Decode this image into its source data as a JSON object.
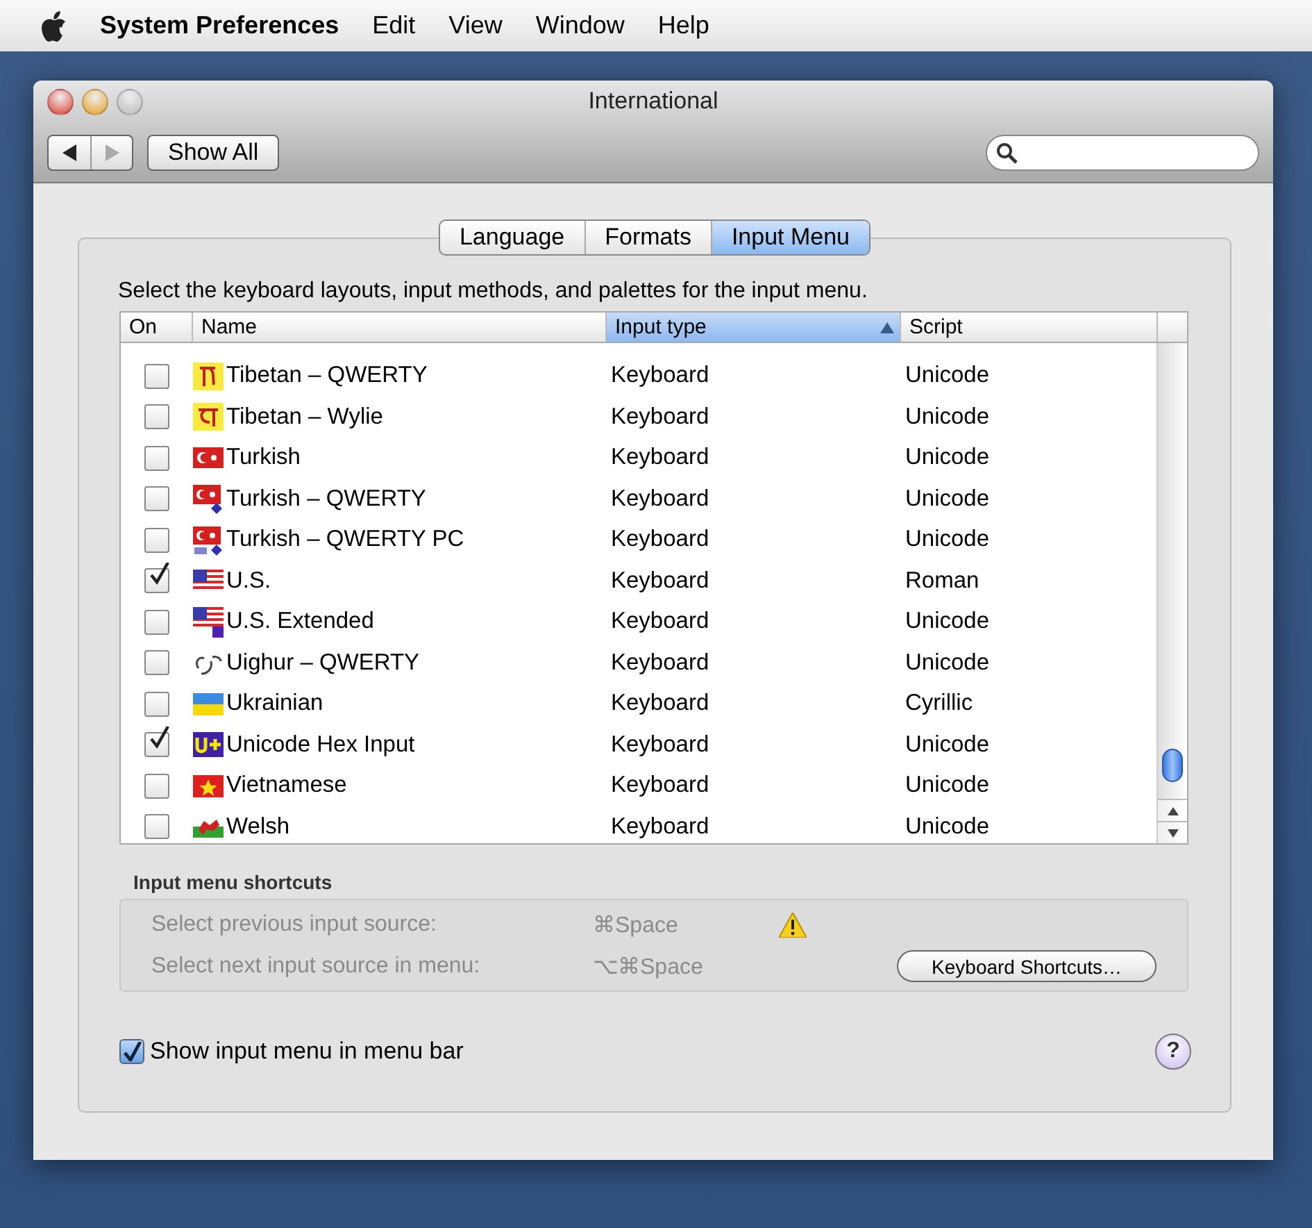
{
  "menu_bar": {
    "app": "System Preferences",
    "items": [
      "Edit",
      "View",
      "Window",
      "Help"
    ]
  },
  "window": {
    "title": "International",
    "show_all": "Show All"
  },
  "tabs": [
    {
      "label": "Language",
      "selected": false
    },
    {
      "label": "Formats",
      "selected": false
    },
    {
      "label": "Input Menu",
      "selected": true
    }
  ],
  "instruction": "Select the keyboard layouts, input methods, and palettes for the input menu.",
  "table": {
    "columns": [
      {
        "label": "On",
        "sorted": false
      },
      {
        "label": "Name",
        "sorted": false
      },
      {
        "label": "Input type",
        "sorted": true
      },
      {
        "label": "Script",
        "sorted": false
      }
    ],
    "rows": [
      {
        "checked": false,
        "name": "Tibetan – QWERTY",
        "type": "Keyboard",
        "script": "Unicode"
      },
      {
        "checked": false,
        "name": "Tibetan – Wylie",
        "type": "Keyboard",
        "script": "Unicode"
      },
      {
        "checked": false,
        "name": "Turkish",
        "type": "Keyboard",
        "script": "Unicode"
      },
      {
        "checked": false,
        "name": "Turkish – QWERTY",
        "type": "Keyboard",
        "script": "Unicode"
      },
      {
        "checked": false,
        "name": "Turkish – QWERTY PC",
        "type": "Keyboard",
        "script": "Unicode"
      },
      {
        "checked": true,
        "name": "U.S.",
        "type": "Keyboard",
        "script": "Roman"
      },
      {
        "checked": false,
        "name": "U.S. Extended",
        "type": "Keyboard",
        "script": "Unicode"
      },
      {
        "checked": false,
        "name": "Uighur – QWERTY",
        "type": "Keyboard",
        "script": "Unicode"
      },
      {
        "checked": false,
        "name": "Ukrainian",
        "type": "Keyboard",
        "script": "Cyrillic"
      },
      {
        "checked": true,
        "name": "Unicode Hex Input",
        "type": "Keyboard",
        "script": "Unicode"
      },
      {
        "checked": false,
        "name": "Vietnamese",
        "type": "Keyboard",
        "script": "Unicode"
      },
      {
        "checked": false,
        "name": "Welsh",
        "type": "Keyboard",
        "script": "Unicode"
      }
    ]
  },
  "shortcuts": {
    "title": "Input menu shortcuts",
    "rows": [
      {
        "label": "Select previous input source:",
        "keys": "⌘Space",
        "warning": true
      },
      {
        "label": "Select next input source in menu:",
        "keys": "⌥⌘Space",
        "warning": false
      }
    ],
    "button": "Keyboard Shortcuts…"
  },
  "show_in_menu_bar": {
    "label": "Show input menu in menu bar",
    "checked": true
  },
  "help": "?"
}
